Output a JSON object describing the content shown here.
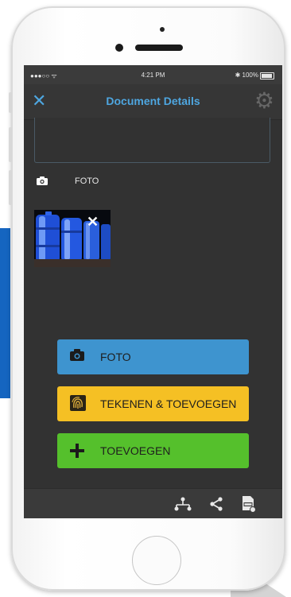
{
  "status_bar": {
    "signal": "●●●○○ ᯤ",
    "time": "4:21 PM",
    "battery": "✱ 100%"
  },
  "nav": {
    "close_icon": "close-icon",
    "close_glyph": "✕",
    "title": "Document Details",
    "settings_icon": "gear-icon",
    "settings_glyph": "⚙"
  },
  "photos_section": {
    "icon": "camera-icon",
    "label": "FOTO",
    "remove_glyph": "✕"
  },
  "actions": {
    "foto": {
      "label": "FOTO",
      "icon": "camera-icon",
      "color": "#3e94cf"
    },
    "teken": {
      "label": "TEKENEN & TOEVOEGEN",
      "icon": "fingerprint-icon",
      "color": "#f5c024"
    },
    "add": {
      "label": "TOEVOEGEN",
      "icon": "plus-icon",
      "color": "#55c02c"
    }
  },
  "toolbar": {
    "items": [
      {
        "icon": "network-icon"
      },
      {
        "icon": "share-icon"
      },
      {
        "icon": "pdf-icon"
      }
    ]
  },
  "colors": {
    "accent": "#4ea6e0",
    "screen_bg": "#323232"
  }
}
